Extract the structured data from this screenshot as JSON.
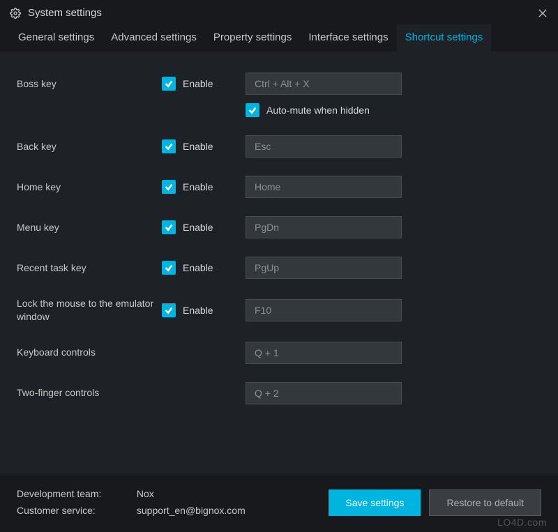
{
  "window": {
    "title": "System settings"
  },
  "tabs": [
    {
      "label": "General settings"
    },
    {
      "label": "Advanced settings"
    },
    {
      "label": "Property settings"
    },
    {
      "label": "Interface settings"
    },
    {
      "label": "Shortcut settings"
    }
  ],
  "active_tab": 4,
  "enable_label": "Enable",
  "automute_label": "Auto-mute when hidden",
  "rows": {
    "boss": {
      "label": "Boss key",
      "value": "Ctrl + Alt + X"
    },
    "back": {
      "label": "Back key",
      "value": "Esc"
    },
    "home": {
      "label": "Home key",
      "value": "Home"
    },
    "menu": {
      "label": "Menu key",
      "value": "PgDn"
    },
    "recent": {
      "label": "Recent task key",
      "value": "PgUp"
    },
    "lock": {
      "label": "Lock the mouse to the emulator window",
      "value": "F10"
    },
    "keyboard": {
      "label": "Keyboard controls",
      "value": "Q + 1"
    },
    "twofinger": {
      "label": "Two-finger controls",
      "value": "Q + 2"
    }
  },
  "footer": {
    "dev_label": "Development team:",
    "dev_value": "Nox",
    "cs_label": "Customer service:",
    "cs_value": "support_en@bignox.com",
    "save": "Save settings",
    "restore": "Restore to default"
  },
  "watermark": "LO4D.com",
  "colors": {
    "accent": "#00b4e0",
    "bg_dark": "#17191c",
    "bg_panel": "#1e2125",
    "input_bg": "#33383d"
  }
}
